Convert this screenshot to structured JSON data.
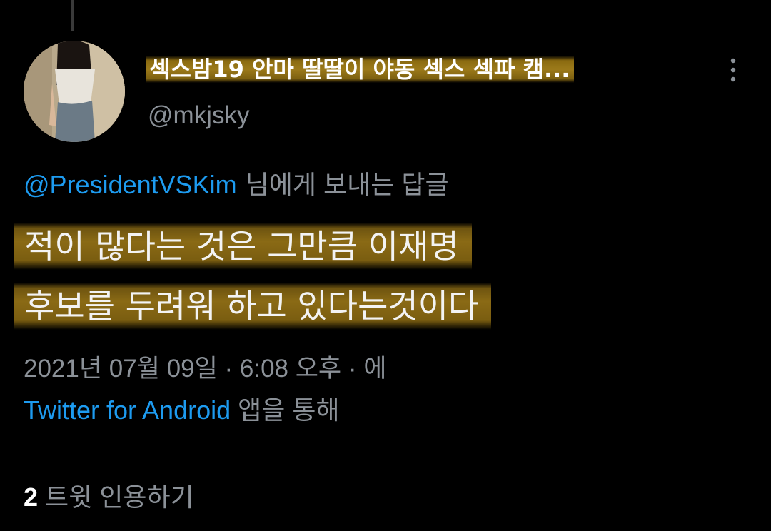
{
  "tweet": {
    "author": {
      "display_name": "섹스밤19 안마 딸딸이 야동 섹스 섹파 캠...",
      "handle": "@mkjsky",
      "avatar_icon": "profile-photo"
    },
    "more_icon": "more-vertical-icon",
    "reply_to": {
      "mention": "@PresidentVSKim",
      "suffix": "님에게 보내는 답글"
    },
    "body_lines": [
      "적이  많다는 것은 그만큼 이재명",
      "후보를 두려워 하고 있다는것이다"
    ],
    "timestamp": "2021년 07월 09일 · 6:08 오후 · 에",
    "source": {
      "app": "Twitter for Android",
      "suffix": "앱을 통해"
    },
    "quotes": {
      "count": "2",
      "label": "트윗 인용하기"
    }
  },
  "colors": {
    "background": "#000000",
    "link": "#1d9bf0",
    "secondary_text": "#8b9198",
    "highlight": "#8a6a15"
  }
}
